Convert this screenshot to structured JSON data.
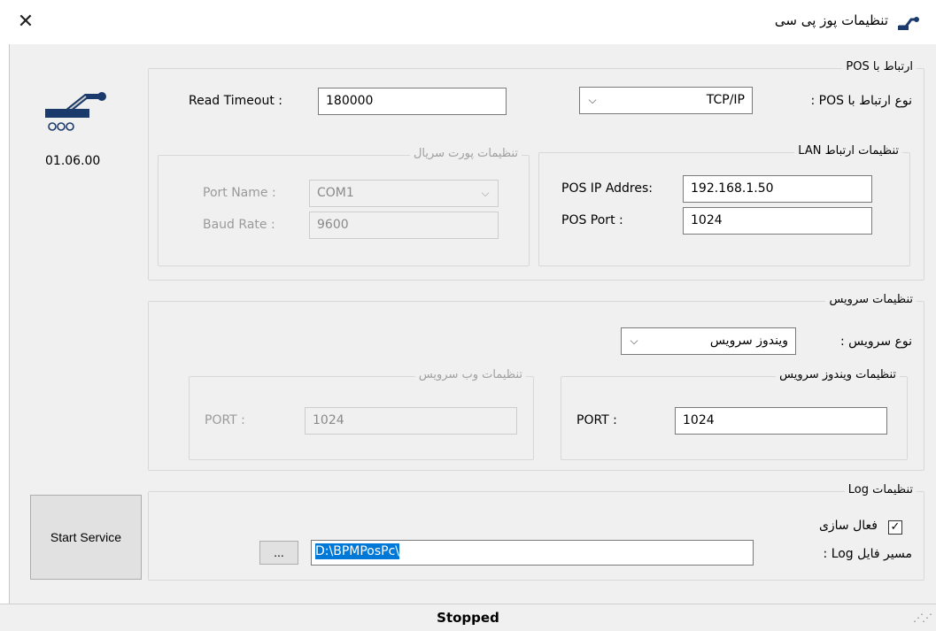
{
  "window": {
    "title": "تنظیمات پوز پی سی",
    "version": "01.06.00",
    "status": "Stopped"
  },
  "pos_connection": {
    "group_title": "ارتباط با POS",
    "connection_type_label": "نوع ارتباط با POS :",
    "connection_type_value": "TCP/IP",
    "read_timeout_label": "Read Timeout :",
    "read_timeout_value": "180000",
    "lan": {
      "group_title": "تنظیمات ارتباط LAN",
      "ip_label": "POS IP Addres:",
      "ip_value": "192.168.1.50",
      "port_label": "POS Port :",
      "port_value": "1024"
    },
    "serial": {
      "group_title": "تنظیمات پورت سریال",
      "port_name_label": "Port Name :",
      "port_name_value": "COM1",
      "baud_rate_label": "Baud Rate :",
      "baud_rate_value": "9600"
    }
  },
  "service": {
    "group_title": "تنظیمات سرویس",
    "service_type_label": "نوع سرویس :",
    "service_type_value": "ویندوز سرویس",
    "windows_service": {
      "group_title": "تنظیمات ویندوز سرویس",
      "port_label": "PORT :",
      "port_value": "1024"
    },
    "web_service": {
      "group_title": "تنظیمات وب سرویس",
      "port_label": "PORT :",
      "port_value": "1024"
    }
  },
  "log": {
    "group_title": "تنظیمات Log",
    "enable_label": "فعال سازی",
    "enabled": true,
    "path_label": "مسیر فایل Log :",
    "path_value": "D:\\BPMPosPc\\",
    "browse_label": "..."
  },
  "buttons": {
    "start_service": "Start Service"
  },
  "icons": {
    "close": "close-icon",
    "logo": "pos-machine-icon"
  }
}
